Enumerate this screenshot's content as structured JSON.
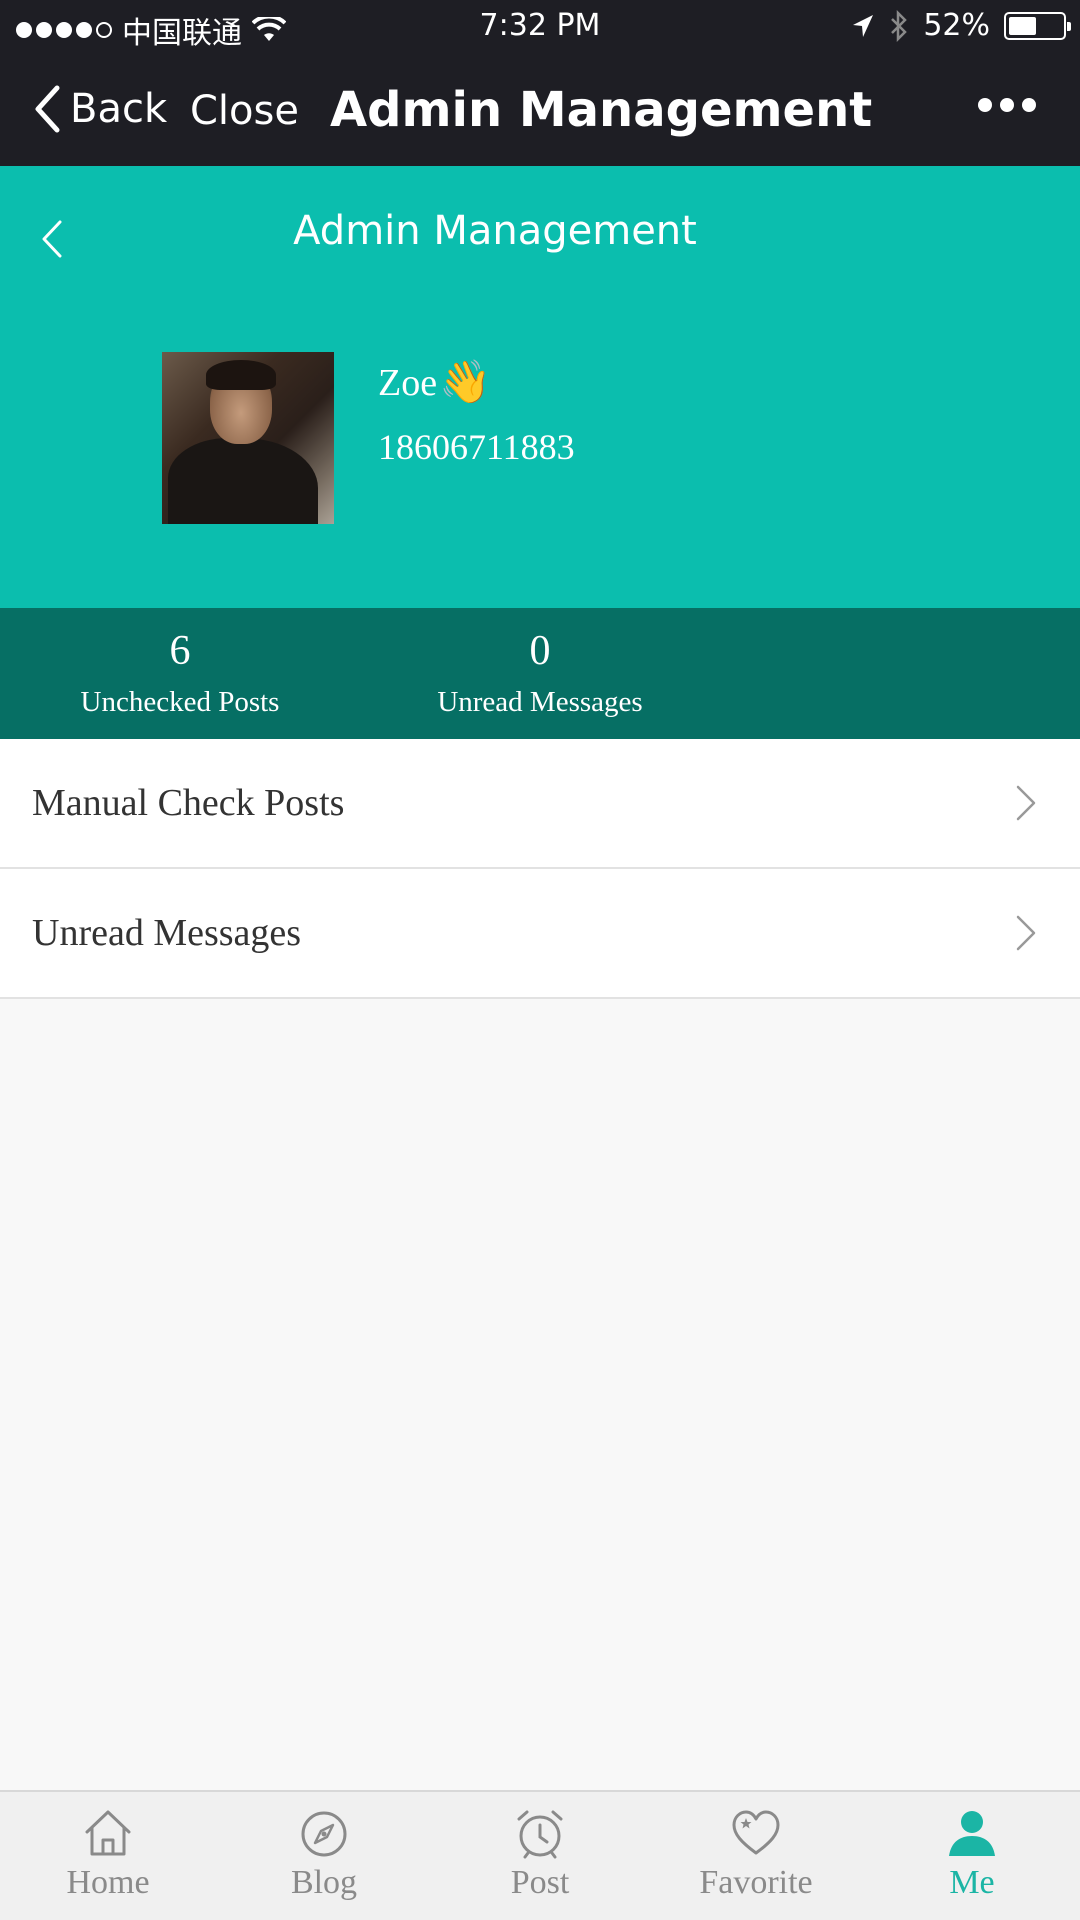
{
  "status_bar": {
    "carrier": "中国联通",
    "time": "7:32 PM",
    "battery": "52%",
    "battery_level": 0.52,
    "signal_bars": 4,
    "signal_max": 5,
    "icons": [
      "wifi-icon",
      "location-arrow-icon",
      "bluetooth-icon",
      "battery-icon"
    ]
  },
  "nav_bar": {
    "back_label": "Back",
    "close_label": "Close",
    "title": "Admin Management",
    "more_icon": "more-dots-icon"
  },
  "header": {
    "title": "Admin Management",
    "background": "#0bbeae",
    "back_icon": "chevron-left-icon"
  },
  "profile": {
    "name": "Zoe",
    "name_emoji": "👋",
    "phone": "18606711883"
  },
  "stats": {
    "background": "#066f64",
    "items": [
      {
        "value": "6",
        "label": "Unchecked Posts"
      },
      {
        "value": "0",
        "label": "Unread Messages"
      }
    ]
  },
  "menu": {
    "items": [
      {
        "label": "Manual Check Posts"
      },
      {
        "label": "Unread Messages"
      }
    ]
  },
  "tab_bar": {
    "active_color": "#1bb5a5",
    "items": [
      {
        "label": "Home",
        "icon": "home-icon",
        "active": false
      },
      {
        "label": "Blog",
        "icon": "compass-icon",
        "active": false
      },
      {
        "label": "Post",
        "icon": "alarm-clock-icon",
        "active": false
      },
      {
        "label": "Favorite",
        "icon": "heart-icon",
        "active": false
      },
      {
        "label": "Me",
        "icon": "person-icon",
        "active": true
      }
    ]
  }
}
